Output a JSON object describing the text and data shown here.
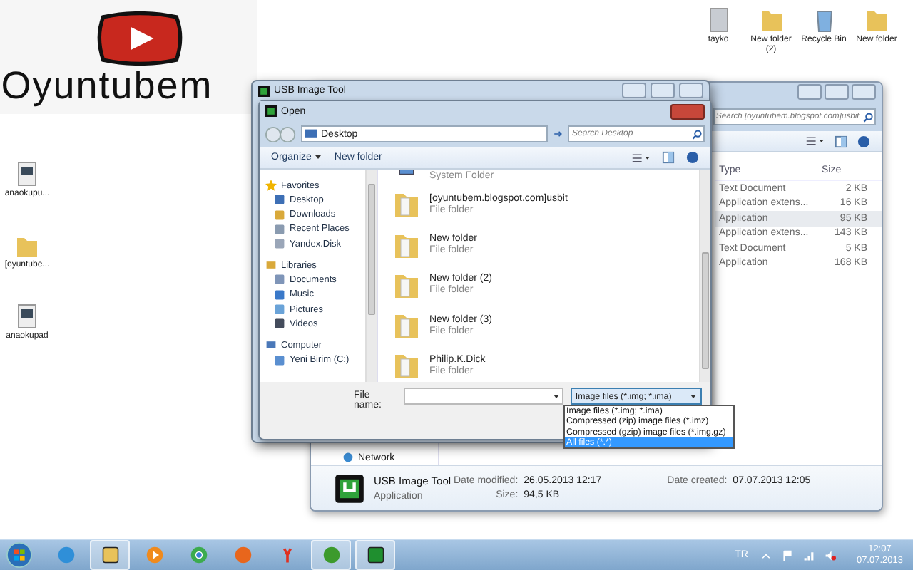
{
  "logo": {
    "text": "Oyuntubem"
  },
  "desktop_icons_left": [
    {
      "label": "anaokupu...",
      "kind": "app"
    },
    {
      "label": "[oyuntube...",
      "kind": "folder"
    },
    {
      "label": "anaokupad",
      "kind": "app"
    }
  ],
  "desktop_icons_top": [
    {
      "label": "tayko",
      "kind": "document"
    },
    {
      "label": "New folder (2)",
      "kind": "folder"
    },
    {
      "label": "Recycle Bin",
      "kind": "recycle"
    },
    {
      "label": "New folder",
      "kind": "folder"
    }
  ],
  "explorer": {
    "search": {
      "placeholder": "Search [oyuntubem.blogspot.com]usbit"
    },
    "columns": [
      "Type",
      "Size"
    ],
    "rows": [
      {
        "type": "Text Document",
        "size": "2 KB",
        "selected": false
      },
      {
        "type": "Application extens...",
        "size": "16 KB",
        "selected": false
      },
      {
        "type": "Application",
        "size": "95 KB",
        "selected": true
      },
      {
        "type": "Application extens...",
        "size": "143 KB",
        "selected": false
      },
      {
        "type": "Text Document",
        "size": "5 KB",
        "selected": false
      },
      {
        "type": "Application",
        "size": "168 KB",
        "selected": false
      }
    ],
    "nav_item": "Network",
    "details": {
      "name": "USB Image Tool",
      "type": "Application",
      "date_modified_label": "Date modified:",
      "date_modified": "26.05.2013 12:17",
      "size_label": "Size:",
      "size": "94,5 KB",
      "date_created_label": "Date created:",
      "date_created": "07.07.2013 12:05"
    }
  },
  "app_window": {
    "title": "USB Image Tool"
  },
  "open_dialog": {
    "title": "Open",
    "address": "Desktop",
    "search": {
      "placeholder": "Search Desktop"
    },
    "organize": "Organize",
    "new_folder": "New folder",
    "nav": [
      {
        "label": "Favorites",
        "kind": "star",
        "children": [
          {
            "label": "Desktop",
            "kind": "desktop"
          },
          {
            "label": "Downloads",
            "kind": "download"
          },
          {
            "label": "Recent Places",
            "kind": "recent"
          },
          {
            "label": "Yandex.Disk",
            "kind": "cloud"
          }
        ]
      },
      {
        "label": "Libraries",
        "kind": "library",
        "children": [
          {
            "label": "Documents",
            "kind": "document"
          },
          {
            "label": "Music",
            "kind": "music"
          },
          {
            "label": "Pictures",
            "kind": "picture"
          },
          {
            "label": "Videos",
            "kind": "video"
          }
        ]
      },
      {
        "label": "Computer",
        "kind": "computer",
        "children": [
          {
            "label": "Yeni Birim (C:)",
            "kind": "drive"
          }
        ]
      }
    ],
    "files": [
      {
        "type": "System Folder",
        "kind": "system"
      },
      {
        "name": "[oyuntubem.blogspot.com]usbit",
        "type": "File folder",
        "kind": "folder"
      },
      {
        "name": "New folder",
        "type": "File folder",
        "kind": "folder"
      },
      {
        "name": "New folder (2)",
        "type": "File folder",
        "kind": "folder"
      },
      {
        "name": "New folder (3)",
        "type": "File folder",
        "kind": "folder"
      },
      {
        "name": "Philip.K.Dick",
        "type": "File folder",
        "kind": "folder"
      }
    ],
    "file_name_label": "File name:",
    "file_type": "Image files (*.img; *.ima)",
    "file_type_options": [
      {
        "label": "Image files (*.img; *.ima)",
        "selected": false
      },
      {
        "label": "Compressed (zip) image files (*.imz)",
        "selected": false
      },
      {
        "label": "Compressed (gzip) image files (*.img.gz)",
        "selected": false
      },
      {
        "label": "All files (*.*)",
        "selected": true
      }
    ]
  },
  "taskbar": {
    "apps": [
      {
        "kind": "ie",
        "running": false
      },
      {
        "kind": "explorer",
        "running": true
      },
      {
        "kind": "media",
        "running": false
      },
      {
        "kind": "chrome",
        "running": false
      },
      {
        "kind": "firefox",
        "running": false
      },
      {
        "kind": "yandex",
        "running": false
      },
      {
        "kind": "torrent",
        "running": true
      },
      {
        "kind": "usbtool",
        "running": true
      }
    ],
    "language": "TR",
    "time": "12:07",
    "date": "07.07.2013"
  }
}
